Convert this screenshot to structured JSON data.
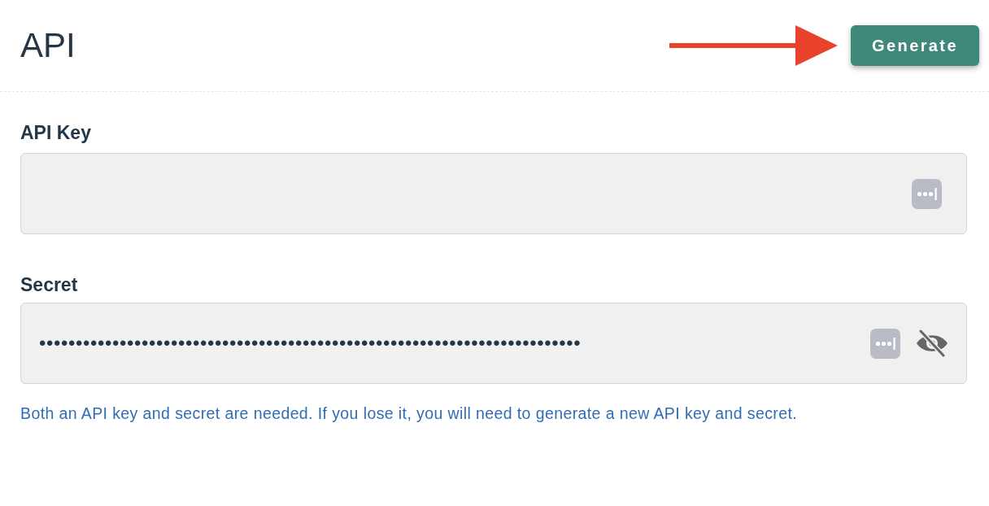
{
  "page": {
    "title": "API",
    "action": {
      "label": "Generate"
    }
  },
  "fields": [
    {
      "kind": "text",
      "label": "API Key"
    },
    {
      "kind": "password",
      "label": "Secret",
      "value": "••••••••••••••••••••••••••••••••••••••••••••••••••••••••••••••••••••••••••",
      "revealed": false
    }
  ],
  "note": "Both an API key and secret are needed. If you lose it, you will need to generate a new API key and secret."
}
